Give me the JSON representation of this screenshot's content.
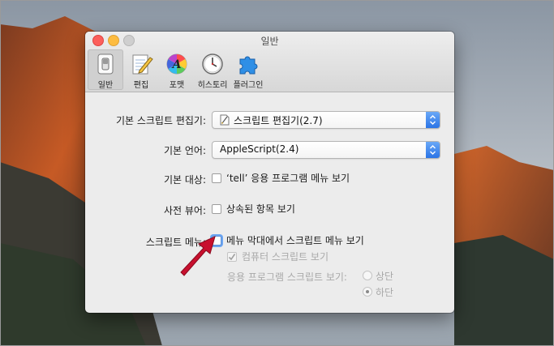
{
  "window": {
    "title": "일반",
    "toolbar": [
      {
        "label": "일반",
        "icon": "switch-icon",
        "active": true
      },
      {
        "label": "편집",
        "icon": "notepad-pencil-icon",
        "active": false
      },
      {
        "label": "포맷",
        "icon": "color-wheel-icon",
        "active": false
      },
      {
        "label": "히스토리",
        "icon": "clock-icon",
        "active": false
      },
      {
        "label": "플러그인",
        "icon": "puzzle-piece-icon",
        "active": false
      }
    ]
  },
  "form": {
    "editor": {
      "label": "기본 스크립트 편집기:",
      "value": "스크립트 편집기(2.7)",
      "icon": "script-document-icon"
    },
    "language": {
      "label": "기본 언어:",
      "value": "AppleScript(2.4)"
    },
    "target": {
      "label": "기본 대상:",
      "checkbox": "‘tell’ 응용 프로그램 메뉴 보기",
      "checked": false
    },
    "dictionary": {
      "label": "사전 뷰어:",
      "checkbox": "상속된 항목 보기",
      "checked": false
    },
    "script_menu": {
      "label": "스크립트 메뉴:",
      "checkbox": "메뉴 막대에서 스크립트 메뉴 보기",
      "checked": false,
      "computer_scripts": {
        "label": "컴퓨터 스크립트 보기",
        "checked": true,
        "enabled": false
      },
      "app_scripts": {
        "label": "응용 프로그램 스크립트 보기:",
        "options": [
          "상단",
          "하단"
        ],
        "selected": "하단",
        "enabled": false
      }
    }
  },
  "colors": {
    "accent_blue": "#2a74e6",
    "annotation_red": "#c8102e",
    "close": "#fc605c",
    "minimize": "#fdbc40"
  }
}
